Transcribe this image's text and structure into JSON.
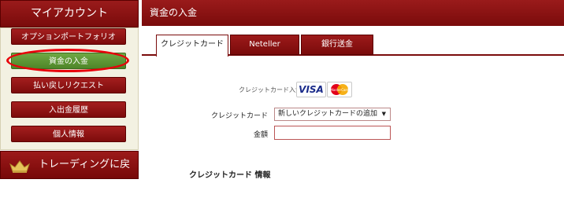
{
  "sidebar": {
    "title": "マイアカウント",
    "items": [
      {
        "label": "オプションポートフォリオ",
        "active": false
      },
      {
        "label": "資金の入金",
        "active": true
      },
      {
        "label": "払い戻しリクエスト",
        "active": false
      },
      {
        "label": "入出金履歴",
        "active": false
      },
      {
        "label": "個人情報",
        "active": false
      }
    ],
    "back_button": {
      "label": "トレーディングに戻る",
      "icon": "crown-icon"
    }
  },
  "main": {
    "title": "資金の入金",
    "tabs": [
      {
        "label": "クレジットカード",
        "active": true
      },
      {
        "label": "Neteller",
        "active": false
      },
      {
        "label": "銀行送金",
        "active": false
      }
    ],
    "card_payment_label": "クレジットカード入金",
    "card_logos": {
      "visa": "VISA",
      "mastercard": "MasterCard"
    },
    "form": {
      "credit_card_label": "クレジットカード",
      "credit_card_selected": "新しいクレジットカードの追加",
      "amount_label": "金額",
      "amount_value": ""
    },
    "section_title": "クレジットカード 情報"
  },
  "colors": {
    "brand_red": "#8b1010",
    "active_green": "#5e9a34",
    "panel_beige": "#f3f1e2",
    "highlight_ring": "#e8000a"
  }
}
